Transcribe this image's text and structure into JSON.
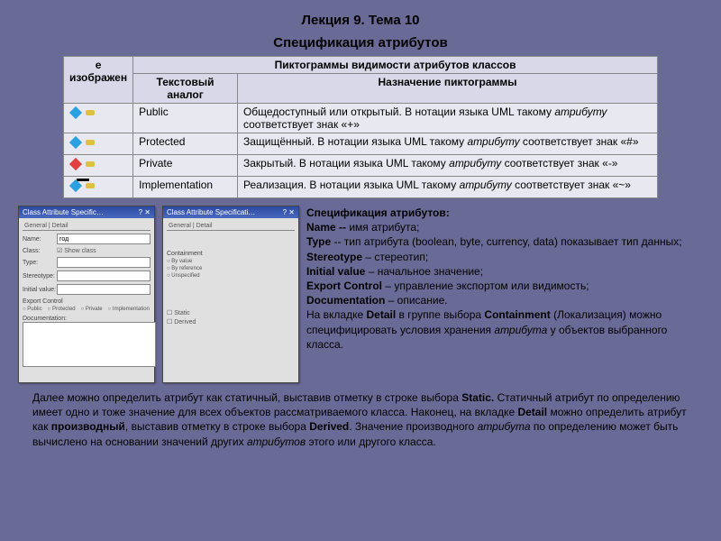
{
  "header": {
    "title": "Лекция 9. Тема 10",
    "subtitle": "Спецификация атрибутов"
  },
  "table": {
    "main_header": "Пиктограммы видимости атрибутов классов",
    "col_image": "е изображен",
    "col_text": "Текстовый аналог",
    "col_purpose": "Назначение пиктограммы",
    "rows": [
      {
        "text": "Public",
        "desc_a": "Общедоступный или открытый. В нотации языка UML такому ",
        "desc_i": "атрибуту",
        "desc_b": " соответствует знак «+»"
      },
      {
        "text": "Protected",
        "desc_a": "Защищённый. В нотации языка UML такому ",
        "desc_i": "атрибуту",
        "desc_b": " соответствует знак «#»"
      },
      {
        "text": "Private",
        "desc_a": "Закрытый. В нотации языка UML такому ",
        "desc_i": "атрибуту",
        "desc_b": " соответствует знак «-»"
      },
      {
        "text": "Implementation",
        "desc_a": "Реализация. В нотации языка UML такому ",
        "desc_i": "атрибуту",
        "desc_b": " соответствует знак «~»"
      }
    ]
  },
  "dialog1": {
    "title": "Class Attribute Specific…",
    "close": "? ✕",
    "tabs": "General | Detail",
    "name_lbl": "Name:",
    "name_val": "год",
    "type_lbl": "Type:",
    "class_lbl": "Class:",
    "class_val": "",
    "show_cls": "☑ Show class",
    "stereo_lbl": "Stereotype:",
    "init_lbl": "Initial value:",
    "export_lbl": "Export Control",
    "radios": [
      "Public",
      "Protected",
      "Private",
      "Implementation"
    ],
    "doc_lbl": "Documentation:"
  },
  "dialog2": {
    "title": "Class Attribute Specificati…",
    "close": "? ✕",
    "tabs": "General | Detail",
    "cont_lbl": "Containment",
    "radios": [
      "By value",
      "By reference",
      "Unspecified"
    ],
    "static": "Static",
    "derived": "Derived"
  },
  "spec": {
    "l1a": "Спецификация атрибутов:",
    "l2a": "Name -- ",
    "l2b": "имя атрибута;",
    "l3a": "Type",
    "l3b": " -- тип атрибута (boolean, byte, currency, data) показывает тип данных;",
    "l4a": "Stereotype",
    "l4b": " – стереотип;",
    "l5a": "Initial value",
    "l5b": " – начальное значение;",
    "l6a": "Export Control",
    "l6b": " – управление экспортом или видимость;",
    "l7a": "Documentation",
    "l7b": " – описание.",
    "l8a": "На вкладке ",
    "l8b": "Detail",
    "l8c": " в группе выбора ",
    "l8d": "Containment",
    "l8e": " (Локализация) можно специфицировать условия хранения ",
    "l8f": "атрибута",
    "l8g": " у объектов выбранного класса."
  },
  "bottom": {
    "p1a": "Далее можно определить атрибут как статичный, выставив отметку в строке выбора ",
    "p1b": "Static.",
    "p1c": " Статичный атрибут по определению имеет одно и тоже значение для всех объектов рассматриваемого класса. Наконец, на вкладке ",
    "p1d": "Detail",
    "p1e": " можно определить атрибут как ",
    "p1f": "производный",
    "p1g": ", выставив отметку в строке выбора ",
    "p1h": "Derived",
    "p1i": ". Значение производного ",
    "p1j": "атрибута",
    "p1k": " по определению может быть вычислено на основании значений других ",
    "p1l": "атрибутов",
    "p1m": " этого или другого класса."
  }
}
